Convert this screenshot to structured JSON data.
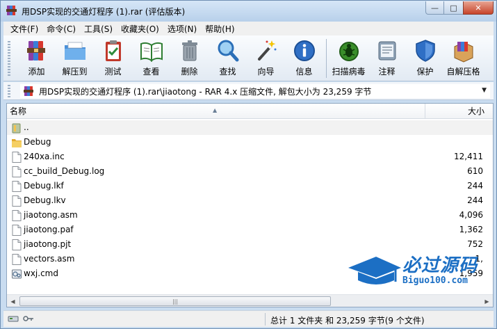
{
  "window": {
    "title": "用DSP实现的交通灯程序 (1).rar (评估版本)",
    "min_symbol": "—",
    "max_symbol": "□",
    "close_symbol": "✕"
  },
  "menu": [
    "文件(F)",
    "命令(C)",
    "工具(S)",
    "收藏夹(O)",
    "选项(N)",
    "帮助(H)"
  ],
  "toolbar": {
    "add": "添加",
    "extract_to": "解压到",
    "test": "测试",
    "view": "查看",
    "delete": "删除",
    "find": "查找",
    "wizard": "向导",
    "info": "信息",
    "virus_scan": "扫描病毒",
    "comment": "注释",
    "protect": "保护",
    "sfx": "自解压格"
  },
  "address": {
    "path": "用DSP实现的交通灯程序 (1).rar\\jiaotong - RAR 4.x 压缩文件, 解包大小为 23,259 字节"
  },
  "list": {
    "columns": {
      "name": "名称",
      "size": "大小"
    },
    "rows": [
      {
        "name": "..",
        "size": "",
        "icon": "folder-up-icon"
      },
      {
        "name": "Debug",
        "size": "",
        "icon": "folder-icon"
      },
      {
        "name": "240xa.inc",
        "size": "12,411",
        "icon": "file-icon"
      },
      {
        "name": "cc_build_Debug.log",
        "size": "610",
        "icon": "file-icon"
      },
      {
        "name": "Debug.lkf",
        "size": "244",
        "icon": "file-icon"
      },
      {
        "name": "Debug.lkv",
        "size": "244",
        "icon": "file-icon"
      },
      {
        "name": "jiaotong.asm",
        "size": "4,096",
        "icon": "file-icon"
      },
      {
        "name": "jiaotong.paf",
        "size": "1,362",
        "icon": "file-icon"
      },
      {
        "name": "jiaotong.pjt",
        "size": "752",
        "icon": "file-icon"
      },
      {
        "name": "vectors.asm",
        "size": "1,",
        "icon": "file-icon"
      },
      {
        "name": "wxj.cmd",
        "size": "1,959",
        "icon": "cmd-file-icon"
      }
    ]
  },
  "status": {
    "summary": "总计 1 文件夹 和 23,259 字节(9 个文件)"
  },
  "watermark": {
    "main": "必过源码",
    "sub": "Biguo100.com"
  },
  "colors": {
    "accent": "#1c6fc4",
    "folder": "#f2c34e",
    "title_bar": "#c9dcf0"
  }
}
